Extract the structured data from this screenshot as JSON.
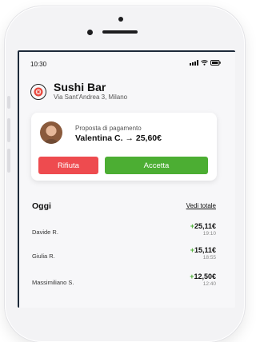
{
  "status_bar": {
    "time": "10:30"
  },
  "header": {
    "venue_name": "Sushi Bar",
    "venue_address": "Via Sant'Andrea 3, Milano"
  },
  "payment_request": {
    "subtitle": "Proposta di pagamento",
    "sender": "Valentina C.",
    "arrow": "→",
    "amount": "25,60€",
    "reject_label": "Rifiuta",
    "accept_label": "Accetta"
  },
  "today": {
    "title": "Oggi",
    "see_all_label": "Vedi totale",
    "transactions": [
      {
        "name": "Davide R.",
        "sign": "+",
        "amount": "25,11€",
        "time": "19:10"
      },
      {
        "name": "Giulia R.",
        "sign": "+",
        "amount": "15,11€",
        "time": "18:55"
      },
      {
        "name": "Massimiliano S.",
        "sign": "+",
        "amount": "12,50€",
        "time": "12:40"
      }
    ]
  },
  "colors": {
    "reject": "#ee4b4f",
    "accept": "#4cae33",
    "positive_amount": "#4cae33"
  }
}
